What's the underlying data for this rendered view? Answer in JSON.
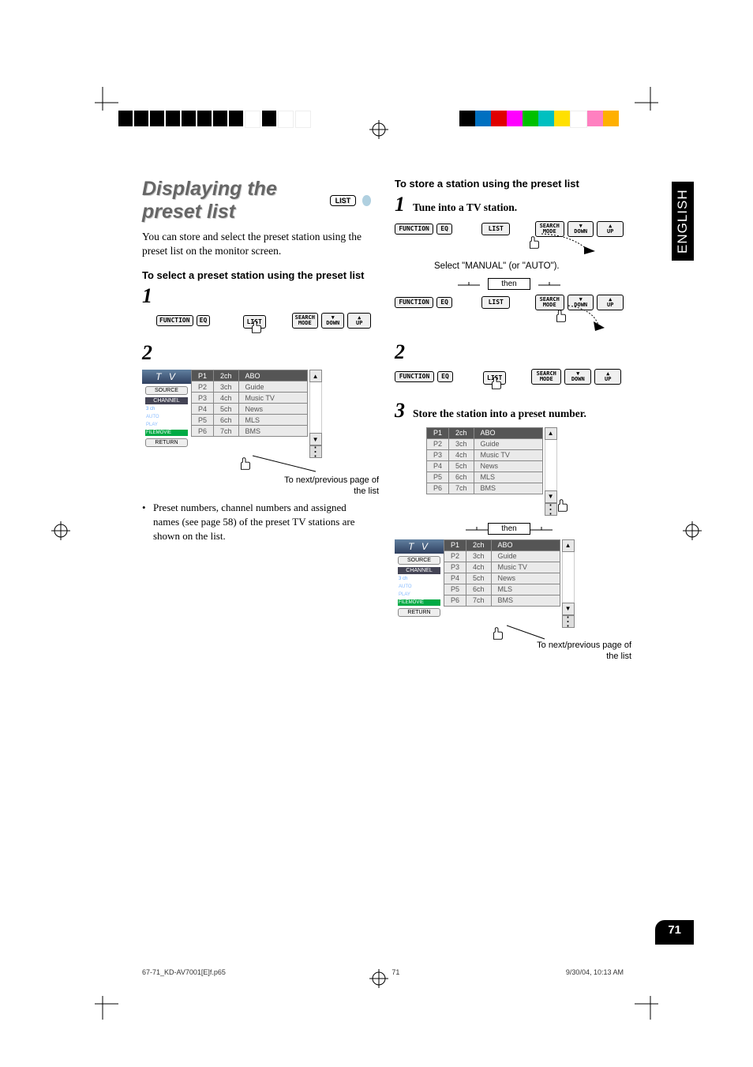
{
  "lang_tab": "ENGLISH",
  "section_title": "Displaying the preset list",
  "list_badge": "LIST",
  "intro_text": "You can store and select the preset station using the preset list on the monitor screen.",
  "sub_heading_select": "To select a preset station using the preset list",
  "sub_heading_store": "To store a station using the preset list",
  "step1": "1",
  "step2": "2",
  "step3": "3",
  "step1_text": "Tune into a TV station.",
  "step3_text": "Store the station into a preset number.",
  "instruction_select": "Select \"MANUAL\" (or \"AUTO\").",
  "then_label": "then",
  "btn": {
    "function": "FUNCTION",
    "eq": "EQ",
    "list": "LIST",
    "search_mode": "SEARCH MODE",
    "down": "DOWN",
    "up": "UP"
  },
  "preset_sidebar": {
    "header": "T V",
    "source": "SOURCE",
    "channel": "CHANNEL",
    "ch_info": "3 ch",
    "auto": "AUTO",
    "play": "PLAY",
    "movie": "FILEMOVIE",
    "return": "RETURN"
  },
  "preset_rows": [
    {
      "p": "P1",
      "ch": "2ch",
      "name": "ABO"
    },
    {
      "p": "P2",
      "ch": "3ch",
      "name": "Guide"
    },
    {
      "p": "P3",
      "ch": "4ch",
      "name": "Music TV"
    },
    {
      "p": "P4",
      "ch": "5ch",
      "name": "News"
    },
    {
      "p": "P5",
      "ch": "6ch",
      "name": "MLS"
    },
    {
      "p": "P6",
      "ch": "7ch",
      "name": "BMS"
    }
  ],
  "caption_page": "To next/previous page of the list",
  "bullet_note": "Preset numbers, channel numbers and assigned names (see page 58) of the preset TV stations are shown on the list.",
  "page_num": "71",
  "footer": {
    "file": "67-71_KD-AV7001[E]f.p65",
    "page": "71",
    "date": "9/30/04, 10:13 AM"
  }
}
